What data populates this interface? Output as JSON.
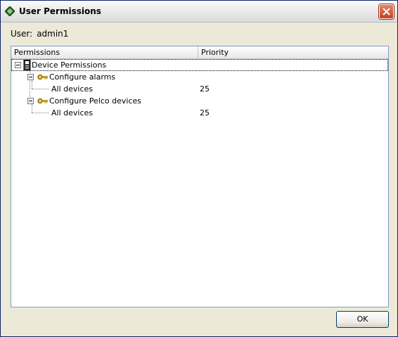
{
  "window": {
    "title": "User Permissions"
  },
  "user": {
    "label": "User:",
    "value": "admin1"
  },
  "table": {
    "columns": [
      "Permissions",
      "Priority"
    ],
    "root": {
      "label": "Device Permissions",
      "icon": "device-icon"
    },
    "groups": [
      {
        "label": "Configure alarms",
        "icon": "key-icon",
        "children": [
          {
            "label": "All devices",
            "priority": "25"
          }
        ]
      },
      {
        "label": "Configure Pelco devices",
        "icon": "key-icon",
        "children": [
          {
            "label": "All devices",
            "priority": "25"
          }
        ]
      }
    ]
  },
  "buttons": {
    "ok": "OK"
  }
}
